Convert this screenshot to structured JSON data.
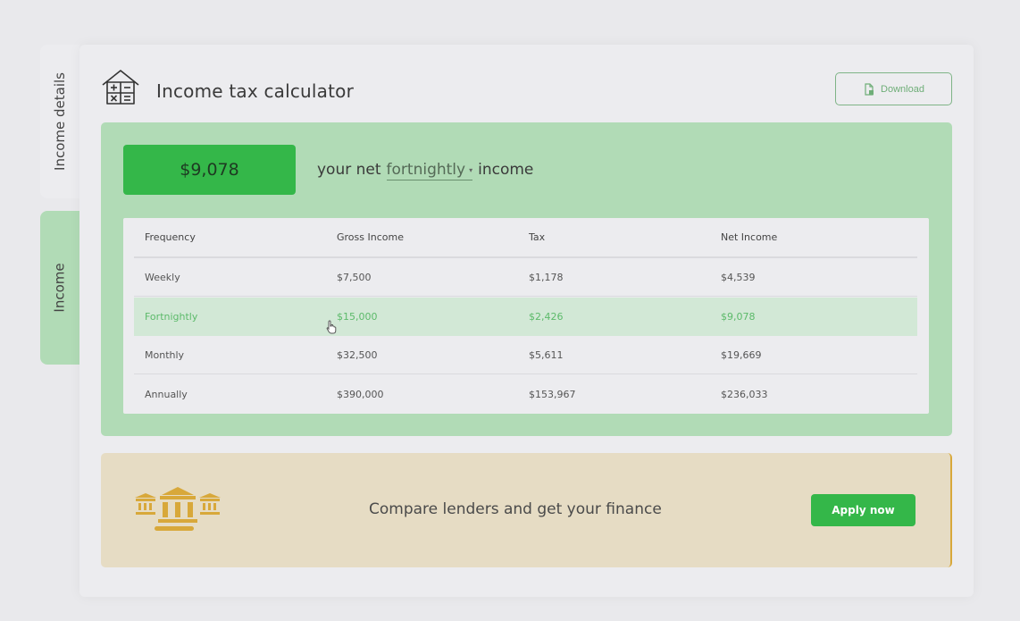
{
  "tabs": {
    "details_label": "Income details",
    "income_label": "Income"
  },
  "header": {
    "title": "Income tax calculator",
    "download_label": "Download"
  },
  "summary": {
    "net_amount": "$9,078",
    "prefix": "your net",
    "frequency": "fortnightly",
    "suffix": "income"
  },
  "table": {
    "headers": [
      "Frequency",
      "Gross Income",
      "Tax",
      "Net Income"
    ],
    "rows": [
      [
        "Weekly",
        "$7,500",
        "$1,178",
        "$4,539"
      ],
      [
        "Fortnightly",
        "$15,000",
        "$2,426",
        "$9,078"
      ],
      [
        "Monthly",
        "$32,500",
        "$5,611",
        "$19,669"
      ],
      [
        "Annually",
        "$390,000",
        "$153,967",
        "$236,033"
      ]
    ],
    "highlighted_row": "Fortnightly"
  },
  "promo": {
    "text": "Compare lenders and get your finance",
    "button_label": "Apply now"
  },
  "colors": {
    "accent_green": "#34b749",
    "panel_green": "#b1dbb6",
    "promo_beige": "#e6dcc4",
    "icon_gold": "#d8a83a"
  },
  "icons": {
    "header": "calculator-house-icon",
    "download": "document-icon",
    "promo": "bank-icon"
  }
}
